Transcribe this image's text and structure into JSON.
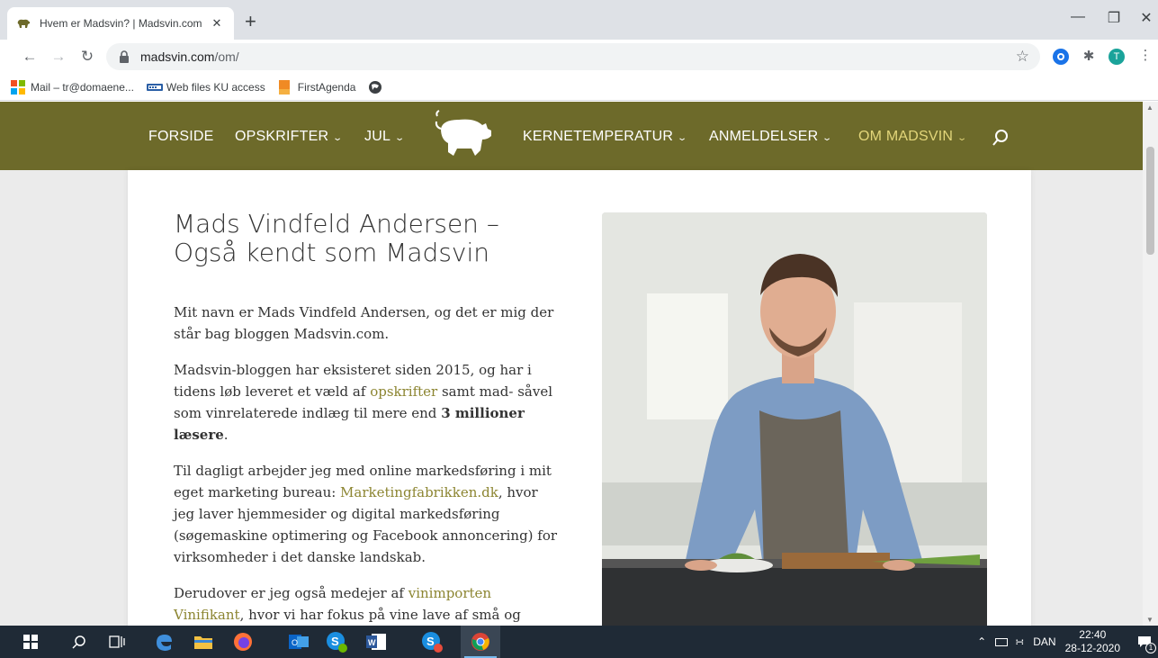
{
  "browser": {
    "tab_title": "Hvem er Madsvin? | Madsvin.com",
    "tab_close": "✕",
    "new_tab": "+",
    "url_host": "madsvin.com",
    "url_path": "/om/",
    "bookmarks": [
      {
        "label": "Mail – tr@domaene...",
        "icon": "microsoft-icon"
      },
      {
        "label": "Web files KU access",
        "icon": "drive-icon"
      },
      {
        "label": "FirstAgenda",
        "icon": "firstagenda-icon"
      },
      {
        "label": "",
        "icon": "globe-icon"
      }
    ],
    "profile_initial": "T"
  },
  "site": {
    "nav": [
      {
        "label": "FORSIDE",
        "caret": false,
        "active": false
      },
      {
        "label": "OPSKRIFTER",
        "caret": true,
        "active": false
      },
      {
        "label": "JUL",
        "caret": true,
        "active": false
      },
      {
        "label": "KERNETEMPERATUR",
        "caret": true,
        "active": false
      },
      {
        "label": "ANMELDELSER",
        "caret": true,
        "active": false
      },
      {
        "label": "OM MADSVIN",
        "caret": true,
        "active": true
      }
    ],
    "nav_color": "#6d6a2a",
    "link_color": "#8c8531",
    "heading": "Mads Vindfeld Andersen – Også kendt som Madsvin",
    "p1": "Mit navn er Mads Vindfeld Andersen, og det er mig der står bag bloggen Madsvin.com.",
    "p2_a": "Madsvin-bloggen har eksisteret siden 2015, og har i tidens løb leveret et væld af ",
    "p2_link": "opskrifter",
    "p2_b": " samt mad- såvel som vinrelaterede indlæg til mere end ",
    "p2_bold": "3 millioner læsere",
    "p2_c": ".",
    "p3_a": "Til dagligt arbejder jeg med online markedsføring i mit eget marketing bureau: ",
    "p3_link": "Marketingfabrikken.dk",
    "p3_b": ", hvor jeg laver hjemmesider og digital markedsføring (søgemaskine optimering og Facebook annoncering) for virksomheder i det danske landskab.",
    "p4_a": "Derudover er jeg også medejer af ",
    "p4_link": "vinimporten Vinifikant",
    "p4_b": ", hvor vi har fokus på vine lave af små og"
  },
  "taskbar": {
    "lang": "DAN",
    "time": "22:40",
    "date": "28-12-2020",
    "notifications": "1"
  }
}
